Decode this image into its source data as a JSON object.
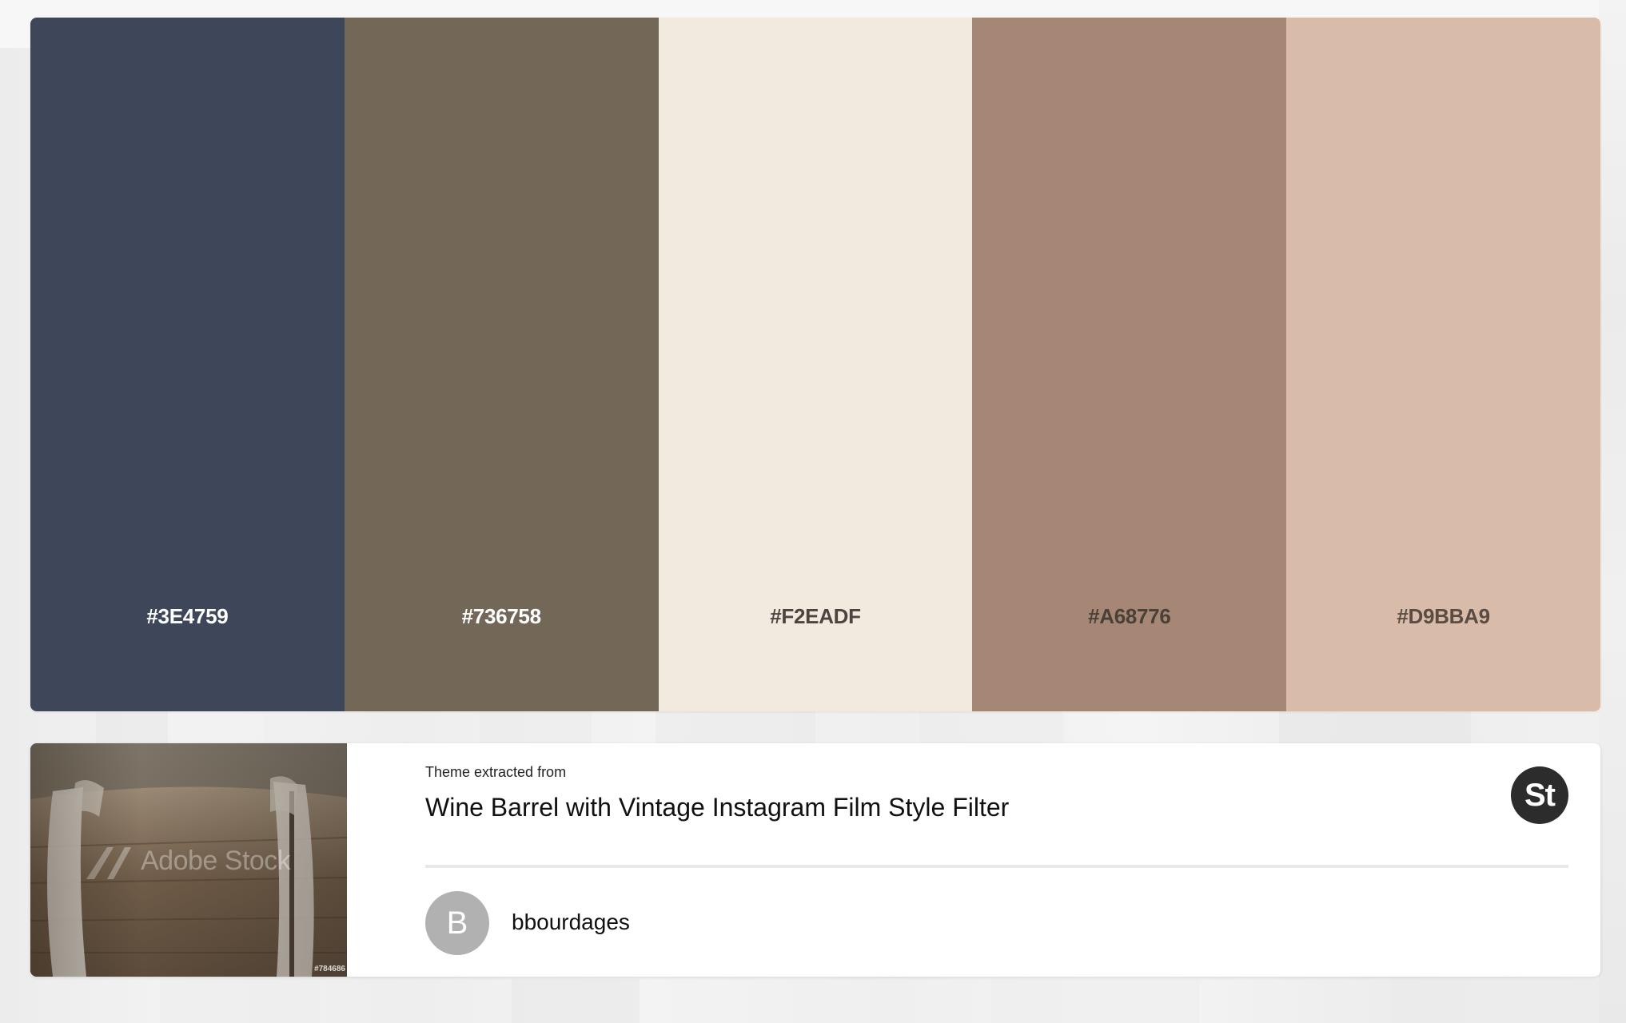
{
  "palette": {
    "swatches": [
      {
        "hex": "#3E4759",
        "label_color": "#ffffff"
      },
      {
        "hex": "#736758",
        "label_color": "#ffffff"
      },
      {
        "hex": "#F2EADF",
        "label_color": "#4a4540"
      },
      {
        "hex": "#A68776",
        "label_color": "#4a4038"
      },
      {
        "hex": "#D9BBA9",
        "label_color": "#5a4c42"
      }
    ]
  },
  "source": {
    "extracted_label": "Theme extracted from",
    "title": "Wine Barrel with Vintage Instagram Film Style Filter",
    "badge": "St",
    "badge_icon": "adobe-stock-icon",
    "thumbnail_watermark": "Adobe Stock",
    "thumbnail_id": "#784686"
  },
  "author": {
    "initial": "B",
    "username": "bbourdages"
  }
}
